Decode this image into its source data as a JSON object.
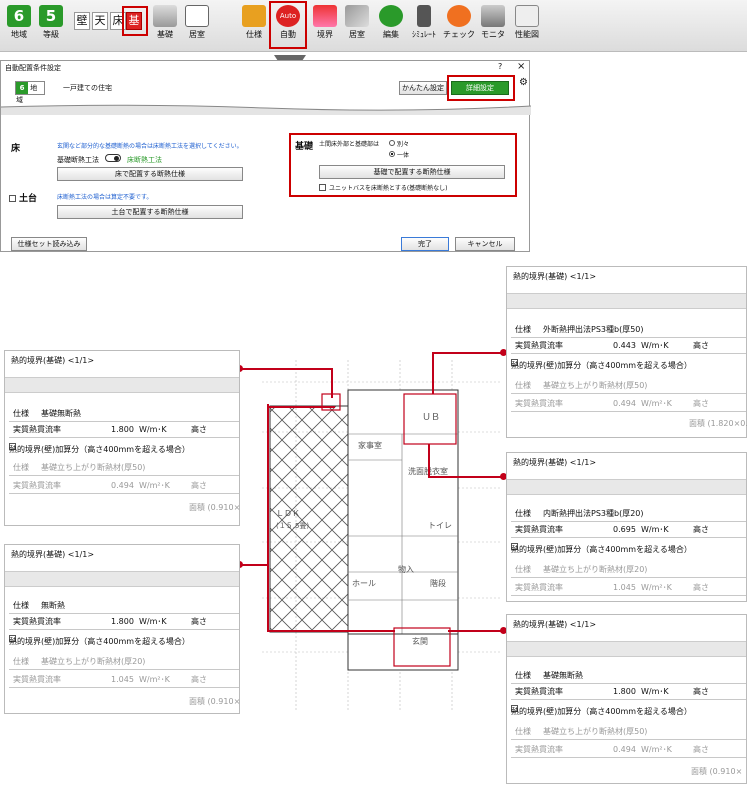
{
  "toolbar": {
    "chiiki_num": "6",
    "chiiki": "地域",
    "toukyuu_num": "5",
    "toukyuu": "等級",
    "kan_kabe": "壁",
    "kan_ten": "天",
    "kan_yuka": "床",
    "kan_ki": "基",
    "kiso": "基礎",
    "kyoshitsu": "居室",
    "shiyou": "仕様",
    "auto_badge": "Auto",
    "jidou": "自動",
    "kyoukai": "境界",
    "kyoshitsu2": "居室",
    "henshuu": "編集",
    "simulate": "ｼﾐｭﾚｰﾄ",
    "check": "チェック",
    "monitor": "モニタ",
    "seinou": "性能図"
  },
  "dialog": {
    "title": "自動配置条件設定",
    "help": "?",
    "close": "×",
    "region_num": "6",
    "region": "地域",
    "house_type": "一戸建ての住宅",
    "easy_btn": "かんたん設定",
    "detail_btn": "詳細設定",
    "floor_label": "床",
    "floor_note": "玄関など部分的な基礎断熱の場合は床断熱工法を選択してください。",
    "method_label": "基礎断熱工法",
    "method_value": "床断熱工法",
    "floor_btn": "床で配置する断熱仕様",
    "dodai_label": "土台",
    "dodai_note": "床断熱工法の場合は算定不要です。",
    "dodai_btn": "土台で配置する断熱仕様",
    "kiso_label": "基礎",
    "kiso_question": "土間床外部と基礎部は",
    "opt_separate": "別々",
    "opt_same": "一体",
    "kiso_btn": "基礎で配置する断熱仕様",
    "unitbath_text": "ユニットバスを床断熱とする(基礎断熱なし)",
    "load_btn": "仕様セット読み込み",
    "ok_btn": "完了",
    "cancel_btn": "キャンセル"
  },
  "panels": {
    "p1": {
      "header": "熱的境界(基礎) <1/1>",
      "spec_label": "仕様",
      "spec": "基礎無断熱",
      "flow_label": "実質熱貫流率",
      "flow": "1.800",
      "unit": "W/m･K",
      "height": "高さ",
      "wall_label": "熱的境界(壁)加算分（高さ400mmを超える場合）",
      "spec2": "基礎立ち上がり断熱材(厚50)",
      "flow2": "0.494",
      "unit2": "W/m²･K",
      "height2": "高さ",
      "area": "面積 (0.910×"
    },
    "p2": {
      "header": "熱的境界(基礎) <1/1>",
      "spec_label": "仕様",
      "spec": "無断熱",
      "flow_label": "実質熱貫流率",
      "flow": "1.800",
      "unit": "W/m･K",
      "height": "高さ",
      "wall_label": "熱的境界(壁)加算分（高さ400mmを超える場合）",
      "spec2": "基礎立ち上がり断熱材(厚20)",
      "flow2": "1.045",
      "unit2": "W/m²･K",
      "height2": "高さ",
      "area": "面積 (0.910×"
    },
    "p3": {
      "header": "熱的境界(基礎) <1/1>",
      "spec_label": "仕様",
      "spec": "外断熱押出法PS3種b(厚50)",
      "flow_label": "実質熱貫流率",
      "flow": "0.443",
      "unit": "W/m･K",
      "height": "高さ",
      "wall_label": "熱的境界(壁)加算分（高さ400mmを超える場合）",
      "spec2": "基礎立ち上がり断熱材(厚50)",
      "flow2": "0.494",
      "unit2": "W/m²･K",
      "height2": "高さ",
      "area": "面積 (1.820×0."
    },
    "p4": {
      "header": "熱的境界(基礎) <1/1>",
      "spec_label": "仕様",
      "spec": "内断熱押出法PS3種b(厚20)",
      "flow_label": "実質熱貫流率",
      "flow": "0.695",
      "unit": "W/m･K",
      "height": "高さ",
      "wall_label": "熱的境界(壁)加算分（高さ400mmを超える場合）",
      "spec2": "基礎立ち上がり断熱材(厚20)",
      "flow2": "1.045",
      "unit2": "W/m²･K",
      "height2": "高さ"
    },
    "p5": {
      "header": "熱的境界(基礎) <1/1>",
      "spec_label": "仕様",
      "spec": "基礎無断熱",
      "flow_label": "実質熱貫流率",
      "flow": "1.800",
      "unit": "W/m･K",
      "height": "高さ",
      "wall_label": "熱的境界(壁)加算分（高さ400mmを超える場合）",
      "spec2": "基礎立ち上がり断熱材(厚50)",
      "flow2": "0.494",
      "unit2": "W/m²･K",
      "height2": "高さ",
      "area": "面積 (0.910×"
    }
  },
  "plan": {
    "ub": "ＵＢ",
    "kajishitsu": "家事室",
    "senmen": "洗面脱衣室",
    "ldk": "ＬＤＫ",
    "toilet": "トイレ",
    "hall": "ホール",
    "mono": "物入",
    "kaidan": "階段",
    "genkan": "玄関",
    "ten": "(１５.5畳)"
  },
  "colors": {
    "accent_red": "#c2001a",
    "green": "#2a9a2a"
  }
}
